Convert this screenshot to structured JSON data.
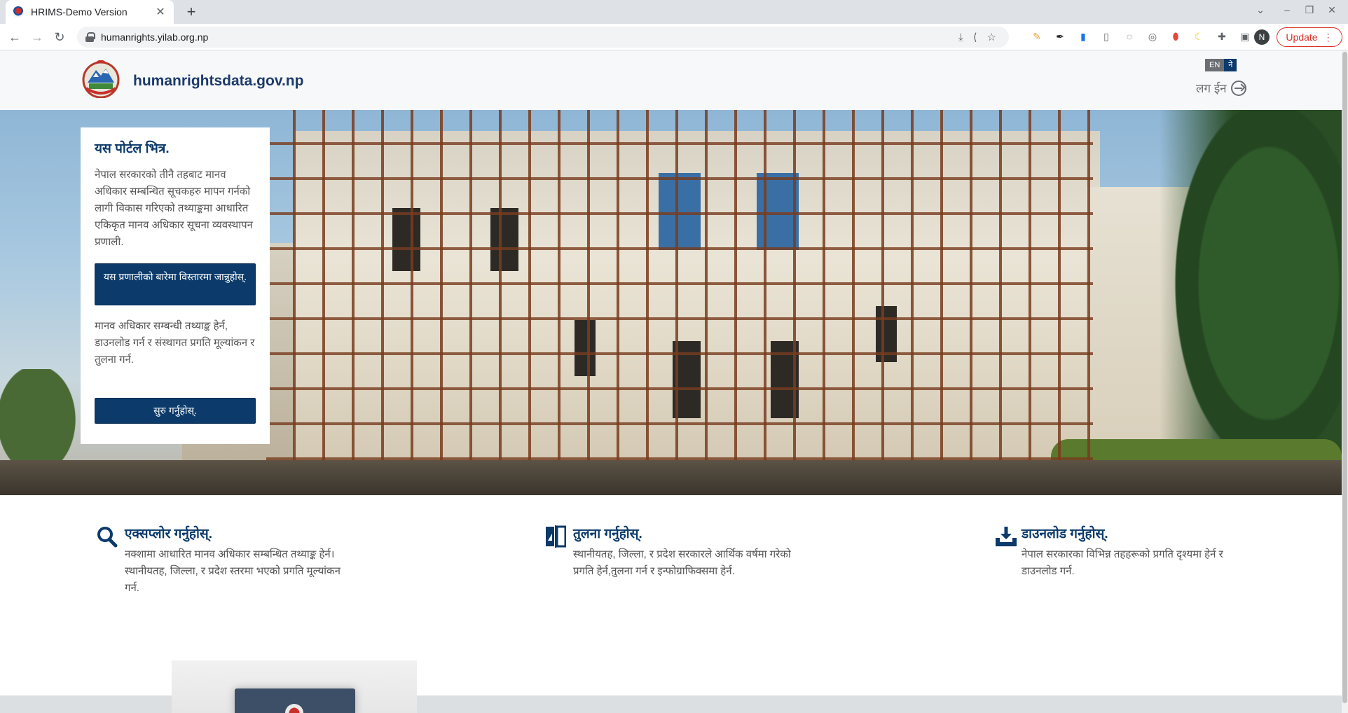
{
  "browser": {
    "tab_title": "HRIMS-Demo Version",
    "url": "humanrights.yilab.org.np",
    "avatar_initial": "N",
    "update_label": "Update"
  },
  "site": {
    "name": "humanrightsdata.gov.np",
    "lang_en": "EN",
    "lang_ne": "ने",
    "login_label": "लग ईन"
  },
  "intro": {
    "heading": "यस पोर्टल भित्र.",
    "description": "नेपाल सरकारको तीनै तहबाट मानव अधिकार सम्बन्धित सूचकहरु मापन गर्नको लागी विकास गरिएको तथ्याङ्कमा आधारित एकिकृत मानव अधिकार सूचना व्यवस्थापन प्रणाली.",
    "about_button": "यस प्रणालीको बारेमा विस्तारमा जान्नुहोस्.",
    "secondary_text": "मानव अधिकार सम्बन्धी तथ्याङ्क हेर्न, डाउनलोड गर्न र संस्थागत प्रगति मूल्यांकन र तुलना गर्न.",
    "start_button": "सुरु गर्नुहोस्."
  },
  "features": [
    {
      "title": "एक्सप्लोर गर्नुहोस्.",
      "text": "नक्शामा आधारित मानव अधिकार सम्बन्धित तथ्याङ्क हेर्न। स्थानीयतह, जिल्ला, र प्रदेश स्तरमा भएको प्रगति मूल्यांकन गर्न.",
      "icon": "search-icon"
    },
    {
      "title": "तुलना गर्नुहोस्.",
      "text": "स्थानीयतह, जिल्ला, र प्रदेश सरकारले आर्थिक वर्षमा गरेको प्रगति हेर्न,तुलना गर्न र इन्फोग्राफिक्समा हेर्न.",
      "icon": "compare-icon"
    },
    {
      "title": "डाउनलोड गर्नुहोस्.",
      "text": "नेपाल सरकारका विभिन्न तहहरूको प्रगति दृश्यमा हेर्न र डाउनलोड गर्न.",
      "icon": "download-icon"
    }
  ],
  "colors": {
    "brand_navy": "#0b3a6b",
    "heading_blue": "#1d3a6b",
    "update_red": "#d93025"
  }
}
